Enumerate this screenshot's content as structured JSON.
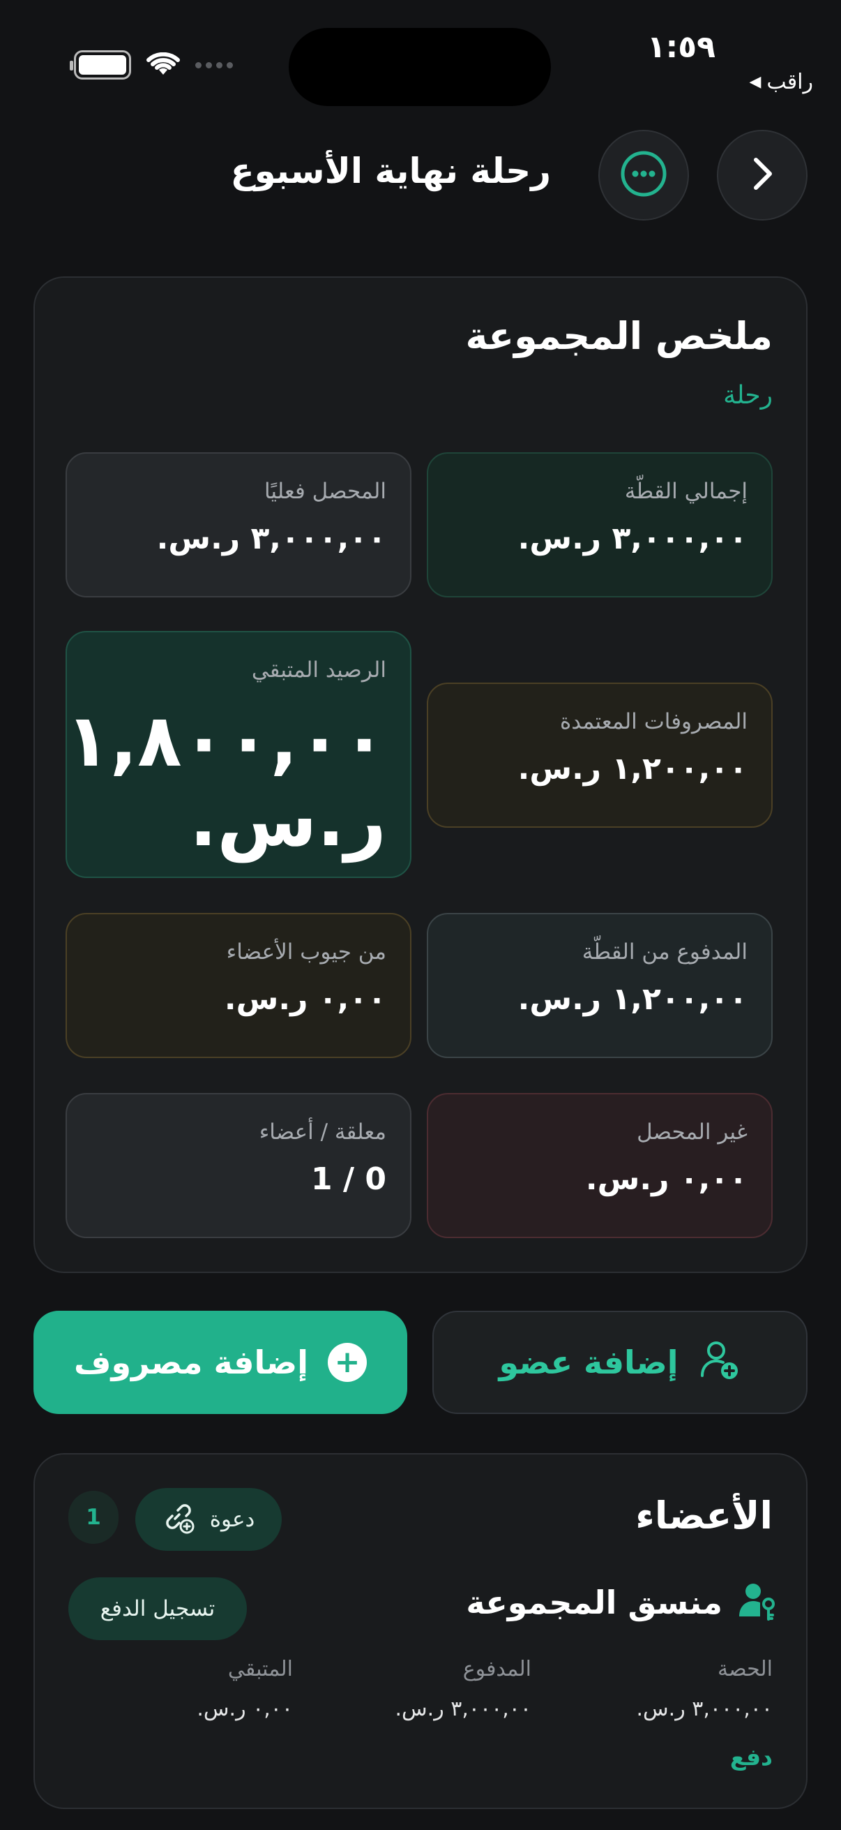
{
  "status_bar": {
    "time": "١:٥٩",
    "carrier": "راقب",
    "carrier_arrow": "◀"
  },
  "header": {
    "title": "رحلة نهاية الأسبوع"
  },
  "summary": {
    "title": "ملخص المجموعة",
    "subtitle": "رحلة",
    "stats": {
      "total_pool": {
        "label": "إجمالي القطّة",
        "value": "٣,٠٠٠,٠٠ ر.س."
      },
      "collected": {
        "label": "المحصل فعليًا",
        "value": "٣,٠٠٠,٠٠ ر.س."
      },
      "approved_expenses": {
        "label": "المصروفات المعتمدة",
        "value": "١,٢٠٠,٠٠ ر.س."
      },
      "remaining_balance": {
        "label": "الرصيد المتبقي",
        "value": "١,٨٠٠,٠٠ ر.س."
      },
      "paid_from_pool": {
        "label": "المدفوع من القطّة",
        "value": "١,٢٠٠,٠٠ ر.س."
      },
      "from_members_pockets": {
        "label": "من جيوب الأعضاء",
        "value": "٠,٠٠ ر.س."
      },
      "uncollected": {
        "label": "غير المحصل",
        "value": "٠,٠٠ ر.س."
      },
      "pending_members": {
        "label": "معلقة / أعضاء",
        "value": "0 / 1"
      }
    }
  },
  "actions": {
    "add_expense": "إضافة مصروف",
    "add_member": "إضافة عضو"
  },
  "members": {
    "title": "الأعضاء",
    "invite_label": "دعوة",
    "count": "1",
    "items": [
      {
        "role": "منسق المجموعة",
        "record_payment": "تسجيل الدفع",
        "share_label": "الحصة",
        "share_value": "٣,٠٠٠,٠٠ ر.س.",
        "paid_label": "المدفوع",
        "paid_value": "٣,٠٠٠,٠٠ ر.س.",
        "remaining_label": "المتبقي",
        "remaining_value": "٠,٠٠ ر.س.",
        "pay_status": "دفع"
      }
    ]
  },
  "colors": {
    "background": "#121315",
    "accent": "#21b18b",
    "card": "#191b1d"
  },
  "icons": {
    "back": "chevron-right-icon",
    "more": "ellipsis-circle-icon",
    "add_expense": "plus-circle-icon",
    "add_member": "person-add-icon",
    "invite": "link-add-icon",
    "coordinator": "person-key-icon"
  }
}
